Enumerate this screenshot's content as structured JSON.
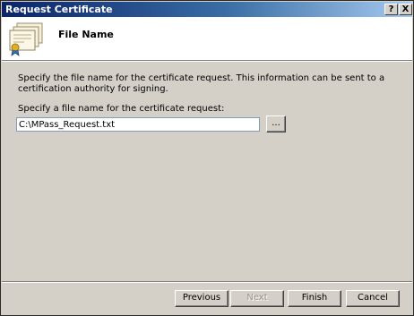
{
  "window": {
    "title": "Request Certificate",
    "help_label": "?",
    "close_label": "X"
  },
  "header": {
    "title": "File Name",
    "icon": "certificate-icon"
  },
  "body": {
    "description": "Specify the file name for the certificate request. This information can be sent to a certification authority for signing.",
    "field_label": "Specify a file name for the certificate request:",
    "file_value": "C:\\MPass_Request.txt",
    "browse_label": "..."
  },
  "buttons": {
    "previous": "Previous",
    "next": "Next",
    "finish": "Finish",
    "cancel": "Cancel",
    "next_enabled": false
  },
  "colors": {
    "titlebar_start": "#0a246a",
    "titlebar_end": "#a6caf0",
    "dialog_bg": "#d4d0c8",
    "header_bg": "#ffffff"
  }
}
